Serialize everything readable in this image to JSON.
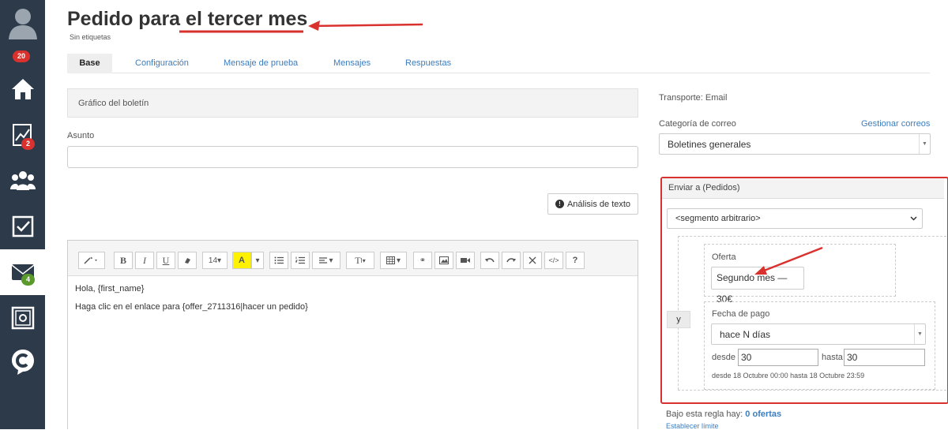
{
  "sidebar": {
    "notifications_count": "20",
    "stats_badge": "2",
    "mail_badge": "4",
    "icons": [
      "avatar-icon",
      "home-icon",
      "stats-icon",
      "users-icon",
      "tasks-icon",
      "mail-icon",
      "safe-icon",
      "logo-c-icon"
    ]
  },
  "page": {
    "title": "Pedido para el tercer mes",
    "tags": "Sin etiquetas"
  },
  "tabs": [
    {
      "label": "Base",
      "active": true
    },
    {
      "label": "Configuración",
      "active": false
    },
    {
      "label": "Mensaje de prueba",
      "active": false
    },
    {
      "label": "Mensajes",
      "active": false
    },
    {
      "label": "Respuestas",
      "active": false
    }
  ],
  "left": {
    "panel_title": "Gráfico del boletín",
    "subject_label": "Asunto",
    "subject_value": "",
    "text_analysis_label": "Análisis de texto",
    "toolbar": {
      "font_size": "14",
      "font_size_caret": "▾",
      "format_caret": "▾",
      "text_style": "T",
      "link_glyph": "⚭",
      "code_glyph": "</>",
      "help_glyph": "?"
    },
    "editor_lines": [
      "Hola, {first_name}",
      "Haga clic en el enlace para {offer_2711316|hacer un pedido}"
    ]
  },
  "right": {
    "transport": "Transporte: Email",
    "category_label": "Categoría de correo",
    "manage_link": "Gestionar correos",
    "category_value": "Boletines generales",
    "send_to_title": "Enviar a (Pedidos)",
    "segment_value": "<segmento arbitrario>",
    "and_label": "y",
    "offer_label": "Oferta",
    "offer_value": "Segundo mes — 30€",
    "payment_label": "Fecha de pago",
    "payment_value": "hace N días",
    "from_label": "desde",
    "from_value": "30",
    "to_label": "hasta",
    "to_value": "30",
    "range_text": "desde 18 Octubre 00:00 hasta 18 Octubre 23:59",
    "rule_count_prefix": "Bajo esta regla hay:",
    "rule_count_value": "0 ofertas",
    "set_limit_link": "Establecer límite"
  },
  "colors": {
    "sidebar_bg": "#2c3a4a",
    "accent_red": "#d9322e",
    "link_blue": "#3b7dbf",
    "badge_green": "#5a9a2a"
  }
}
